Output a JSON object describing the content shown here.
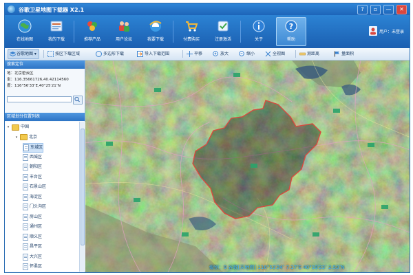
{
  "app": {
    "title": "谷歌卫星地图下载器 X2.1"
  },
  "window_buttons": [
    "?",
    "▫",
    "—",
    "✕"
  ],
  "ribbon": {
    "buttons": [
      {
        "label": "在线地图",
        "icon": "globe-icon"
      },
      {
        "label": "我的下载",
        "icon": "download-list-icon"
      },
      {
        "label": "推荐产品",
        "icon": "products-icon"
      },
      {
        "label": "用户论坛",
        "icon": "forum-icon"
      },
      {
        "label": "我要下载",
        "icon": "ie-browser-icon"
      },
      {
        "label": "付费购买",
        "icon": "cart-icon"
      },
      {
        "label": "注册激活",
        "icon": "register-icon"
      },
      {
        "label": "关于",
        "icon": "info-icon"
      },
      {
        "label": "帮助",
        "icon": "help-icon"
      }
    ],
    "active": "帮助",
    "user": "用户：未登录"
  },
  "toolbar": {
    "items": [
      {
        "label": "谷歌地图 ▾",
        "icon": "map-layer-icon"
      },
      {
        "label": "按区下载区域",
        "icon": "region-download-icon"
      },
      {
        "label": "多边形下载",
        "icon": "polygon-icon"
      },
      {
        "label": "导入下载范围",
        "icon": "import-icon"
      },
      {
        "label": "平移",
        "icon": "pan-icon"
      },
      {
        "label": "放大",
        "icon": "zoom-in-icon"
      },
      {
        "label": "缩小",
        "icon": "zoom-out-icon"
      },
      {
        "label": "全视图",
        "icon": "full-view-icon"
      },
      {
        "label": "测距离",
        "icon": "ruler-icon"
      },
      {
        "label": "量面积",
        "icon": "flag-icon"
      }
    ]
  },
  "position_panel": {
    "title": "搜索定位",
    "lines": [
      "地：北京密云区",
      "坐：116.35661726,40.42114560",
      "度：116°56′33″E,40°25′21″N"
    ],
    "search_placeholder": ""
  },
  "region_panel": {
    "title": "区域划分位置列表",
    "tree": [
      {
        "label": "中国",
        "level": 0,
        "type": "folder",
        "expanded": true
      },
      {
        "label": "北京",
        "level": 1,
        "type": "folder",
        "expanded": true
      },
      {
        "label": "东城区",
        "level": 2,
        "type": "page",
        "selected": true
      },
      {
        "label": "西城区",
        "level": 2,
        "type": "page"
      },
      {
        "label": "朝阳区",
        "level": 2,
        "type": "page"
      },
      {
        "label": "丰台区",
        "level": 2,
        "type": "page"
      },
      {
        "label": "石景山区",
        "level": 2,
        "type": "page"
      },
      {
        "label": "海淀区",
        "level": 2,
        "type": "page"
      },
      {
        "label": "门头沟区",
        "level": 2,
        "type": "page"
      },
      {
        "label": "房山区",
        "level": 2,
        "type": "page"
      },
      {
        "label": "通州区",
        "level": 2,
        "type": "page"
      },
      {
        "label": "顺义区",
        "level": 2,
        "type": "page"
      },
      {
        "label": "昌平区",
        "level": 2,
        "type": "page"
      },
      {
        "label": "大兴区",
        "level": 2,
        "type": "page"
      },
      {
        "label": "怀柔区",
        "level": 2,
        "type": "page"
      }
    ]
  },
  "status": {
    "text": "级别：9    谷歌[天地图]  116°53′24″ 7.17″E    40°19′23″ 2.53″N"
  },
  "colors": {
    "ribbon": "#1d64b8",
    "highlight_boundary": "#d94a3f",
    "panel_title": "#2d74c5",
    "status_text": "#3fb8ff"
  }
}
